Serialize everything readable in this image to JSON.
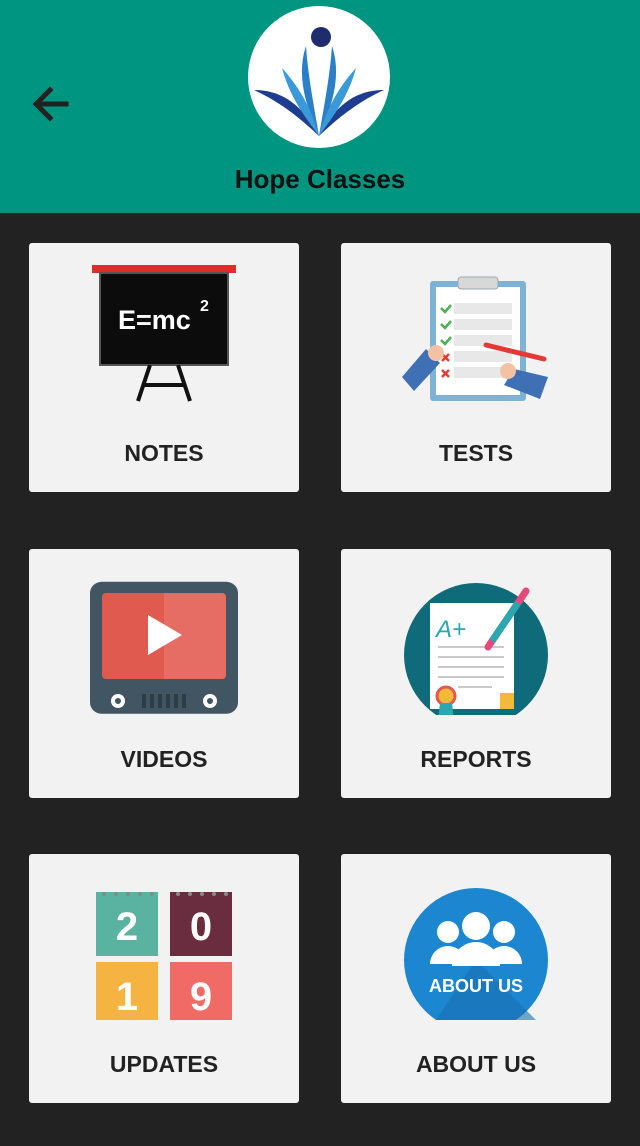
{
  "header": {
    "title": "Hope Classes",
    "back_icon": "arrow-left-icon",
    "logo_icon": "hope-classes-logo",
    "background_color": "#009580"
  },
  "menu": {
    "items": [
      {
        "label": "NOTES",
        "icon": "blackboard-icon",
        "board_text": "E=mc",
        "board_sup": "2"
      },
      {
        "label": "TESTS",
        "icon": "clipboard-test-icon"
      },
      {
        "label": "VIDEOS",
        "icon": "tv-play-icon"
      },
      {
        "label": "REPORTS",
        "icon": "report-card-icon",
        "grade": "A+"
      },
      {
        "label": "UPDATES",
        "icon": "calendar-2019-icon",
        "digits": [
          "2",
          "0",
          "1",
          "9"
        ]
      },
      {
        "label": "ABOUT US",
        "icon": "about-us-icon",
        "badge_text": "ABOUT US"
      }
    ]
  }
}
